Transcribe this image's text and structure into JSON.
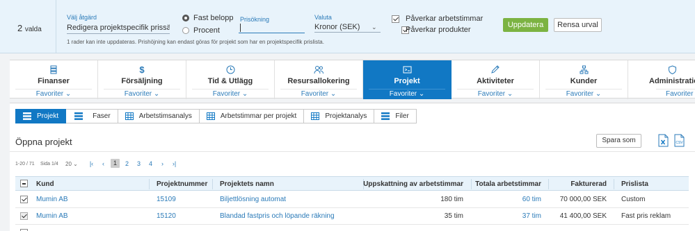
{
  "bulk": {
    "selected_count": "2",
    "selected_suffix": "valda",
    "action_label": "Välj åtgärd",
    "action_value": "Redigera projektspecifik prissättning",
    "radio_fixed": "Fast belopp",
    "radio_percent": "Procent",
    "increase_label": "Prisökning",
    "increase_value": "",
    "currency_label": "Valuta",
    "currency_value": "Kronor (SEK)",
    "affects_hours": "Påverkar arbetstimmar",
    "affects_products": "Påverkar produkter",
    "update_button": "Uppdatera",
    "clear_button": "Rensa urval",
    "note": "1 rader kan inte uppdateras. Prishöjning kan endast göras för projekt som har en projektspecifik prislista."
  },
  "modules": [
    {
      "name": "Finanser",
      "fav": "Favoriter",
      "icon": "coins-icon"
    },
    {
      "name": "Försäljning",
      "fav": "Favoriter",
      "icon": "dollar-icon"
    },
    {
      "name": "Tid & Utlägg",
      "fav": "Favoriter",
      "icon": "clock-icon"
    },
    {
      "name": "Resursallokering",
      "fav": "Favoriter",
      "icon": "people-icon"
    },
    {
      "name": "Projekt",
      "fav": "Favoriter",
      "icon": "project-icon"
    },
    {
      "name": "Aktiviteter",
      "fav": "Favoriter",
      "icon": "pencil-icon"
    },
    {
      "name": "Kunder",
      "fav": "Favoriter",
      "icon": "org-icon"
    },
    {
      "name": "Administration",
      "fav": "Favoriter",
      "icon": "shield-icon"
    }
  ],
  "subtabs": [
    {
      "label": "Projekt"
    },
    {
      "label": "Faser"
    },
    {
      "label": "Arbetstimsanalys"
    },
    {
      "label": "Arbetstimmar per projekt"
    },
    {
      "label": "Projektanalys"
    },
    {
      "label": "Filer"
    }
  ],
  "panel_title": "Öppna projekt",
  "save_as": "Spara som",
  "pager": {
    "range": "1-20 / 71",
    "page": "Sida 1/4",
    "size": "20",
    "pages": [
      "1",
      "2",
      "3",
      "4"
    ]
  },
  "table": {
    "headers": {
      "customer": "Kund",
      "number": "Projektnummer",
      "name": "Projektets namn",
      "estimate": "Uppskattning av arbetstimmar",
      "total": "Totala arbetstimmar",
      "invoiced": "Fakturerad",
      "pricelist": "Prislista"
    },
    "rows": [
      {
        "checked": true,
        "customer": "Mumin AB",
        "number": "15109",
        "name": "Biljettlösning automat",
        "estimate": "180 tim",
        "total": "60 tim",
        "invoiced": "70 000,00 SEK",
        "pricelist": "Custom"
      },
      {
        "checked": true,
        "customer": "Mumin AB",
        "number": "15120",
        "name": "Blandad fastpris och löpande räkning",
        "estimate": "35 tim",
        "total": "37 tim",
        "invoiced": "41 400,00 SEK",
        "pricelist": "Fast pris reklam"
      }
    ]
  },
  "colors": {
    "accent": "#1178c4",
    "update_green": "#7cb342",
    "link": "#2a7ab8"
  }
}
